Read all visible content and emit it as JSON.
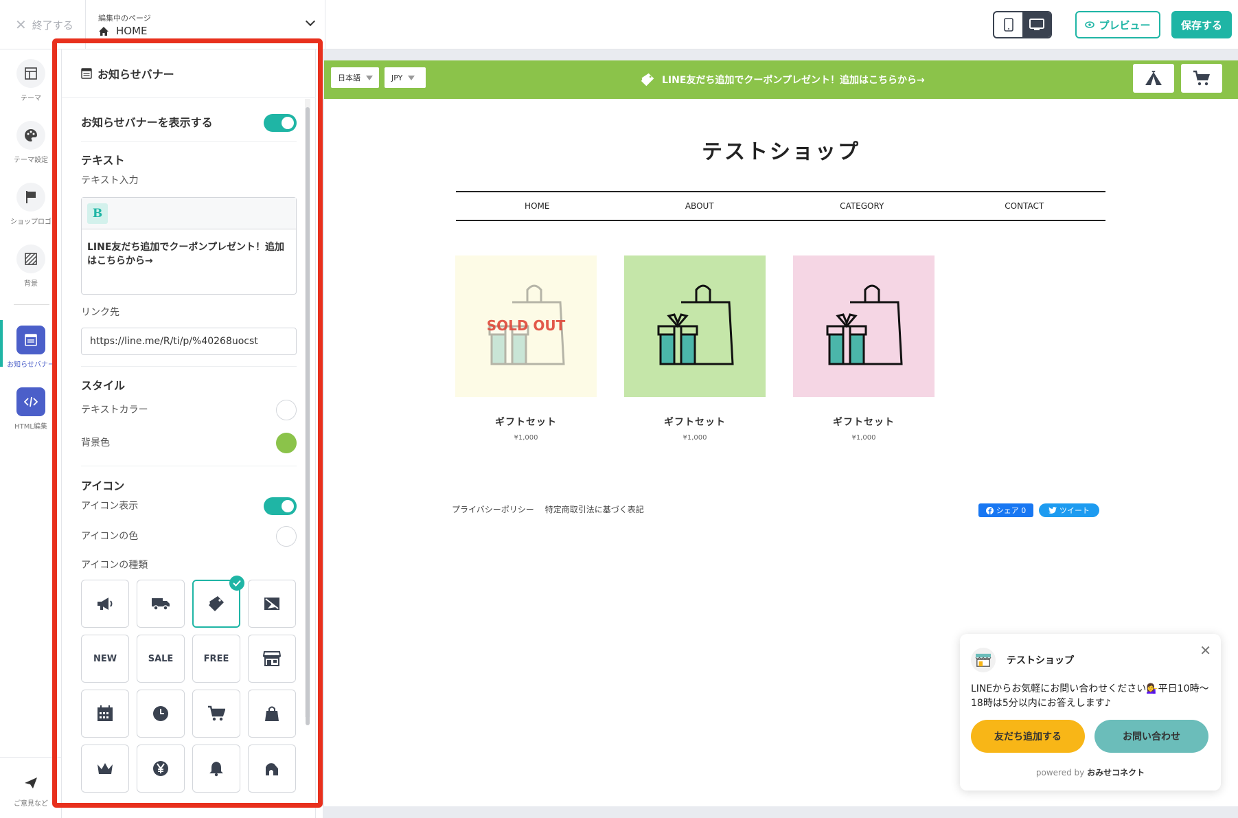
{
  "topbar": {
    "exit_label": "終了する",
    "page_caption": "編集中のページ",
    "page_name": "HOME",
    "preview_label": "プレビュー",
    "save_label": "保存する"
  },
  "leftnav": {
    "items": [
      {
        "label": "テーマ"
      },
      {
        "label": "テーマ設定"
      },
      {
        "label": "ショップロゴ"
      },
      {
        "label": "背景"
      },
      {
        "label": "お知らせバナー"
      },
      {
        "label": "HTML編集"
      }
    ],
    "feedback_label": "ご意見など"
  },
  "panel": {
    "title": "お知らせバナー",
    "show_banner_label": "お知らせバナーを表示する",
    "show_banner_on": true,
    "text_section": "テキスト",
    "text_input_label": "テキスト入力",
    "bold_button": "B",
    "text_value": "LINE友だち追加でクーポンプレゼント！追加はこちらから→",
    "link_label": "リンク先",
    "link_value": "https://line.me/R/ti/p/%40268uocst",
    "style_section": "スタイル",
    "text_color_label": "テキストカラー",
    "text_color": "#ffffff",
    "bg_color_label": "背景色",
    "bg_color": "#8bc34a",
    "icon_section": "アイコン",
    "icon_display_label": "アイコン表示",
    "icon_display_on": true,
    "icon_color_label": "アイコンの色",
    "icon_color": "#ffffff",
    "icon_type_label": "アイコンの種類",
    "icon_types": [
      {
        "name": "megaphone-icon"
      },
      {
        "name": "truck-icon"
      },
      {
        "name": "ticket-icon",
        "selected": true
      },
      {
        "name": "image-icon"
      },
      {
        "name": "new-icon",
        "text": "NEW"
      },
      {
        "name": "sale-icon",
        "text": "SALE"
      },
      {
        "name": "free-icon",
        "text": "FREE"
      },
      {
        "name": "store-icon"
      },
      {
        "name": "calendar-icon"
      },
      {
        "name": "clock-icon"
      },
      {
        "name": "cart-icon"
      },
      {
        "name": "bag-icon"
      },
      {
        "name": "crown-icon"
      },
      {
        "name": "yen-icon"
      },
      {
        "name": "bell-icon"
      },
      {
        "name": "gift-icon"
      }
    ]
  },
  "site": {
    "language": "日本語",
    "currency": "JPY",
    "banner_text": "LINE友だち追加でクーポンプレゼント！追加はこちらから→",
    "shop_title": "テストショップ",
    "menu": [
      "HOME",
      "ABOUT",
      "CATEGORY",
      "CONTACT"
    ],
    "products": [
      {
        "name": "ギフトセット",
        "price": "¥1,000",
        "bg": "#fdfbe6",
        "sold_out": "SOLD OUT"
      },
      {
        "name": "ギフトセット",
        "price": "¥1,000",
        "bg": "#c5e6a9"
      },
      {
        "name": "ギフトセット",
        "price": "¥1,000",
        "bg": "#f5d6e4"
      }
    ],
    "footer_links": [
      "プライバシーポリシー",
      "特定商取引法に基づく表記"
    ],
    "fb_share": "シェア 0",
    "tweet": "ツイート"
  },
  "chat": {
    "shop_name": "テストショップ",
    "message": "LINEからお気軽にお問い合わせください💁‍♀️平日10時〜18時は5分以内にお答えします♪",
    "add_friend": "友だち追加する",
    "contact": "お問い合わせ",
    "powered_by": "powered by",
    "brand": "おみせコネクト"
  },
  "colors": {
    "accent": "#1fb5a5",
    "banner": "#8bc34a",
    "highlight": "#e8301d"
  }
}
